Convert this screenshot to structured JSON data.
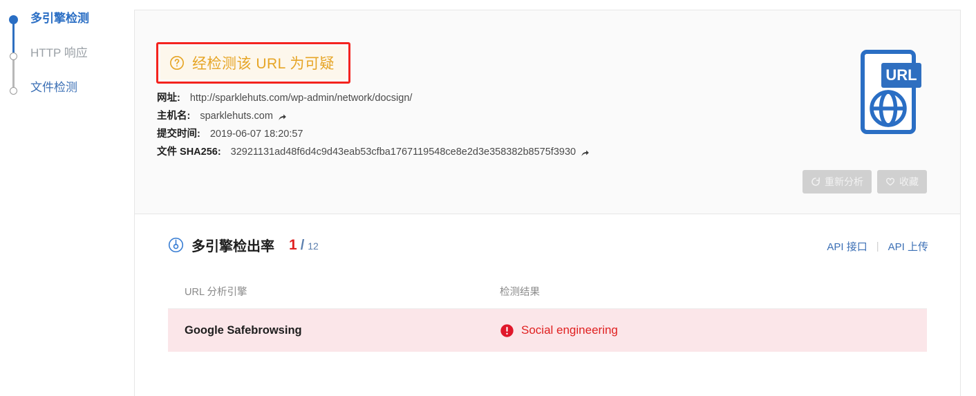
{
  "sidenav": {
    "items": [
      {
        "label": "多引擎检测",
        "state": "active",
        "icon": "filled-node-icon"
      },
      {
        "label": "HTTP 响应",
        "state": "muted",
        "icon": "hollow-node-icon"
      },
      {
        "label": "文件检测",
        "state": "link",
        "icon": "hollow-node-icon"
      }
    ]
  },
  "alert": {
    "icon": "question-circle-icon",
    "text": "经检测该 URL 为可疑",
    "text_color": "#e6a526",
    "background": "#fdf7ec",
    "highlight_border_color": "#f4231e"
  },
  "details": [
    {
      "label": "网址:",
      "value": "http://sparklehuts.com/wp-admin/network/docsign/",
      "share": false
    },
    {
      "label": "主机名:",
      "value": "sparklehuts.com",
      "share": true,
      "share_icon": "share-arrow-icon"
    },
    {
      "label": "提交时间:",
      "value": "2019-06-07 18:20:57",
      "share": false
    },
    {
      "label": "文件 SHA256:",
      "value": "32921131ad48f6d4c9d43eab53cfba1767119548ce8e2d3e358382b8575f3930",
      "share": true,
      "share_icon": "share-arrow-icon"
    }
  ],
  "file_icon": {
    "name": "url-document-icon",
    "badge_label": "URL",
    "color": "#2a6ec4"
  },
  "actions": [
    {
      "label": "重新分析",
      "icon": "refresh-icon",
      "disabled": true
    },
    {
      "label": "收藏",
      "icon": "heart-icon",
      "disabled": true
    }
  ],
  "detection": {
    "icon": "gauge-icon",
    "title": "多引擎检出率",
    "hits": "1",
    "slash": "/",
    "total": "12",
    "hit_color": "#e02020",
    "total_color": "#5b7fae",
    "api_links": [
      {
        "label": "API 接口"
      },
      {
        "label": "API 上传"
      }
    ],
    "api_separator": "|",
    "table": {
      "columns": [
        "URL 分析引擎",
        "检测结果"
      ],
      "rows": [
        {
          "engine": "Google Safebrowsing",
          "result": "Social engineering",
          "result_icon": "exclamation-circle-icon",
          "severity": "malicious",
          "row_background": "#fbe6e9",
          "result_color": "#e02020"
        }
      ]
    }
  }
}
